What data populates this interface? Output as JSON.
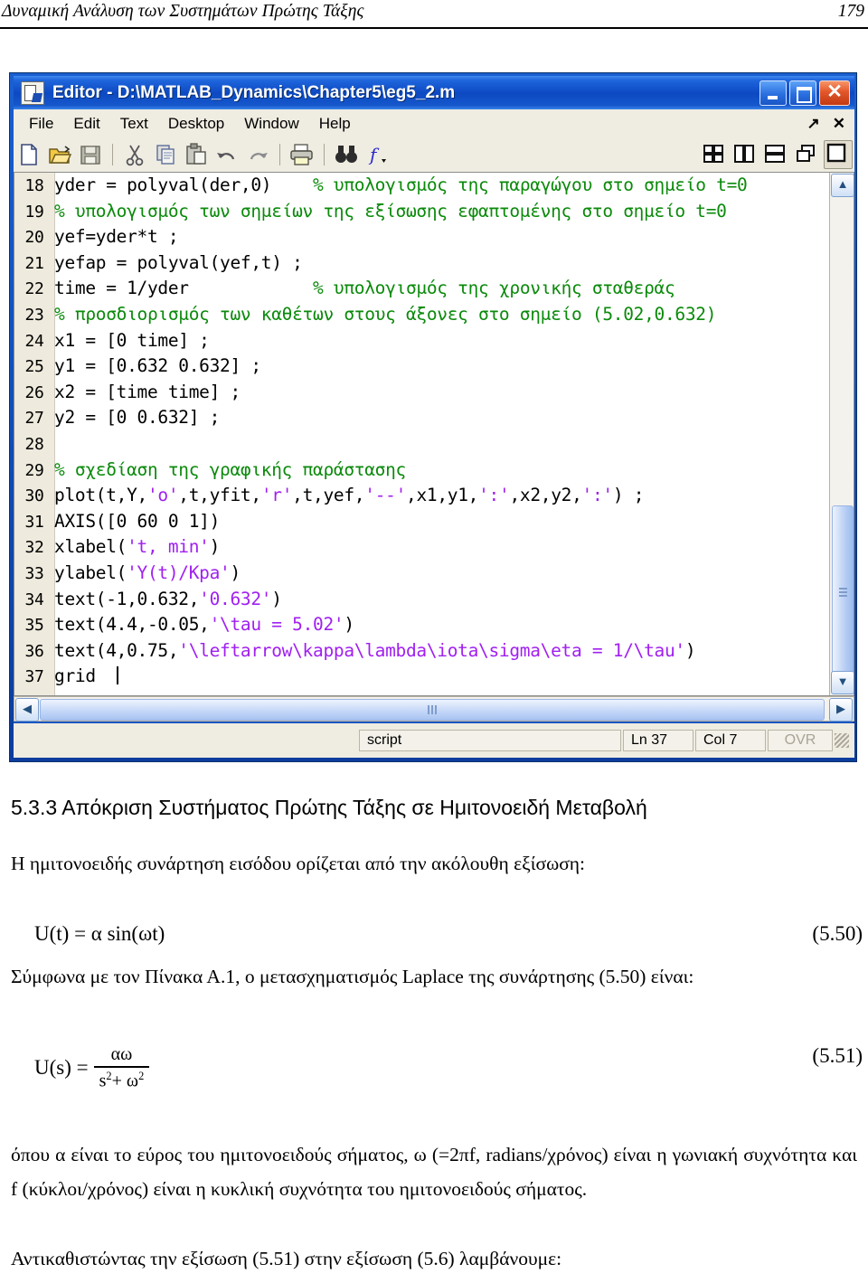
{
  "page_header": {
    "title": "Δυναμική Ανάλυση των Συστημάτων Πρώτης Τάξης",
    "page_number": "179"
  },
  "editor": {
    "title": "Editor - D:\\MATLAB_Dynamics\\Chapter5\\eg5_2.m",
    "title_icon": "matlab-editor-icon",
    "window_buttons": {
      "minimize": "_",
      "maximize": "□",
      "close": "✕"
    },
    "menu": [
      {
        "label": "File"
      },
      {
        "label": "Edit"
      },
      {
        "label": "Text"
      },
      {
        "label": "Desktop"
      },
      {
        "label": "Window"
      },
      {
        "label": "Help"
      }
    ],
    "menubar_right": {
      "undock": "↗",
      "close": "✕"
    },
    "toolbar": [
      {
        "name": "new-file-icon",
        "tip": "New"
      },
      {
        "name": "open-file-icon",
        "tip": "Open"
      },
      {
        "name": "save-file-icon",
        "tip": "Save"
      },
      {
        "name": "cut-icon",
        "tip": "Cut"
      },
      {
        "name": "copy-icon",
        "tip": "Copy"
      },
      {
        "name": "paste-icon",
        "tip": "Paste"
      },
      {
        "name": "undo-icon",
        "tip": "Undo"
      },
      {
        "name": "redo-icon",
        "tip": "Redo"
      },
      {
        "name": "print-icon",
        "tip": "Print"
      },
      {
        "name": "find-icon",
        "tip": "Find"
      },
      {
        "name": "function-icon",
        "tip": "Function"
      }
    ],
    "toolbar_right": [
      {
        "name": "tile-four-icon",
        "tip": "Tile"
      },
      {
        "name": "tile-vertical-icon",
        "tip": "Tile Vertically"
      },
      {
        "name": "tile-horizontal-icon",
        "tip": "Tile Horizontally"
      },
      {
        "name": "cascade-icon",
        "tip": "Cascade"
      },
      {
        "name": "maximize-pane-icon",
        "tip": "Maximize",
        "pressed": true
      }
    ],
    "code_lines": [
      {
        "no": "18",
        "segments": [
          {
            "t": "yder = polyval(der,0)    ",
            "c": ""
          },
          {
            "t": "% υπολογισμός της παραγώγου στο σημείο t=0",
            "c": "tok-c"
          }
        ]
      },
      {
        "no": "19",
        "segments": [
          {
            "t": "% υπολογισμός των σημείων της εξίσωσης εφαπτομένης στο σημείο t=0",
            "c": "tok-c"
          }
        ]
      },
      {
        "no": "20",
        "segments": [
          {
            "t": "yef=yder*t ;",
            "c": ""
          }
        ]
      },
      {
        "no": "21",
        "segments": [
          {
            "t": "yefap = polyval(yef,t) ;",
            "c": ""
          }
        ]
      },
      {
        "no": "22",
        "segments": [
          {
            "t": "time = 1/yder            ",
            "c": ""
          },
          {
            "t": "% υπολογισμός της χρονικής σταθεράς",
            "c": "tok-c"
          }
        ]
      },
      {
        "no": "23",
        "segments": [
          {
            "t": "% προσδιορισμός των καθέτων στους άξονες στο σημείο (5.02,0.632)",
            "c": "tok-c"
          }
        ]
      },
      {
        "no": "24",
        "segments": [
          {
            "t": "x1 = [0 time] ;",
            "c": ""
          }
        ]
      },
      {
        "no": "25",
        "segments": [
          {
            "t": "y1 = [0.632 0.632] ;",
            "c": ""
          }
        ]
      },
      {
        "no": "26",
        "segments": [
          {
            "t": "x2 = [time time] ;",
            "c": ""
          }
        ]
      },
      {
        "no": "27",
        "segments": [
          {
            "t": "y2 = [0 0.632] ;",
            "c": ""
          }
        ]
      },
      {
        "no": "28",
        "segments": [
          {
            "t": "",
            "c": ""
          }
        ]
      },
      {
        "no": "29",
        "segments": [
          {
            "t": "% σχεδίαση της γραφικής παράστασης",
            "c": "tok-c"
          }
        ]
      },
      {
        "no": "30",
        "segments": [
          {
            "t": "plot(t,Y,",
            "c": ""
          },
          {
            "t": "'o'",
            "c": "tok-s"
          },
          {
            "t": ",t,yfit,",
            "c": ""
          },
          {
            "t": "'r'",
            "c": "tok-s"
          },
          {
            "t": ",t,yef,",
            "c": ""
          },
          {
            "t": "'--'",
            "c": "tok-s"
          },
          {
            "t": ",x1,y1,",
            "c": ""
          },
          {
            "t": "':'",
            "c": "tok-s"
          },
          {
            "t": ",x2,y2,",
            "c": ""
          },
          {
            "t": "':'",
            "c": "tok-s"
          },
          {
            "t": ") ;",
            "c": ""
          }
        ]
      },
      {
        "no": "31",
        "segments": [
          {
            "t": "AXIS([0 60 0 1])",
            "c": ""
          }
        ]
      },
      {
        "no": "32",
        "segments": [
          {
            "t": "xlabel(",
            "c": ""
          },
          {
            "t": "'t, min'",
            "c": "tok-s"
          },
          {
            "t": ")",
            "c": ""
          }
        ]
      },
      {
        "no": "33",
        "segments": [
          {
            "t": "ylabel(",
            "c": ""
          },
          {
            "t": "'Y(t)/Kpa'",
            "c": "tok-s"
          },
          {
            "t": ")",
            "c": ""
          }
        ]
      },
      {
        "no": "34",
        "segments": [
          {
            "t": "text(-1,0.632,",
            "c": ""
          },
          {
            "t": "'0.632'",
            "c": "tok-s"
          },
          {
            "t": ")",
            "c": ""
          }
        ]
      },
      {
        "no": "35",
        "segments": [
          {
            "t": "text(4.4,-0.05,",
            "c": ""
          },
          {
            "t": "'\\tau = 5.02'",
            "c": "tok-s"
          },
          {
            "t": ")",
            "c": ""
          }
        ]
      },
      {
        "no": "36",
        "segments": [
          {
            "t": "text(4,0.75,",
            "c": ""
          },
          {
            "t": "'\\leftarrow\\kappa\\lambda\\iota\\sigma\\eta = 1/\\tau'",
            "c": "tok-s"
          },
          {
            "t": ")",
            "c": ""
          }
        ]
      },
      {
        "no": "37",
        "segments": [
          {
            "t": "grid  ",
            "c": ""
          }
        ],
        "caret": true
      }
    ],
    "scrollbars": {
      "v_up": "▲",
      "v_down": "▼",
      "h_left": "◀",
      "h_right": "▶"
    },
    "statusbar": {
      "file_type": "script",
      "line": "Ln  37",
      "column": "Col  7",
      "overwrite": "OVR"
    },
    "colors": {
      "titlebar_blue": "#0c49c2",
      "close_red": "#e2572a",
      "comment_green": "#0b8a0b",
      "string_purple": "#a020f0",
      "chrome": "#efece1"
    }
  },
  "document": {
    "section_heading": "5.3.3  Απόκριση Συστήματος Πρώτης Τάξης σε Ημιτονοειδή Μεταβολή",
    "intro_paragraph": "Η ημιτονοειδής συνάρτηση εισόδου ορίζεται από την ακόλουθη εξίσωση:",
    "equation_50": {
      "body": "U(t) = α sin(ωt)",
      "number": "(5.50)"
    },
    "laplace_paragraph": "Σύμφωνα με τον Πίνακα Α.1, ο μετασχηματισμός Laplace της συνάρτησης (5.50) είναι:",
    "equation_51": {
      "lhs": "U(s) =",
      "numerator": "αω",
      "denominator_base1": "s",
      "denominator_exp1": "2",
      "denominator_plus": "+ ω",
      "denominator_exp2": "2",
      "number": "(5.51)"
    },
    "where_paragraph": "όπου α είναι το εύρος του ημιτονοειδούς σήματος, ω (=2πf, radians/χρόνος) είναι η γωνιακή συχνότητα και f (κύκλοι/χρόνος) είναι η κυκλική συχνότητα του ημιτονοειδούς σήματος.",
    "substitution_paragraph": "Αντικαθιστώντας την εξίσωση (5.51) στην εξίσωση (5.6) λαμβάνουμε:"
  }
}
